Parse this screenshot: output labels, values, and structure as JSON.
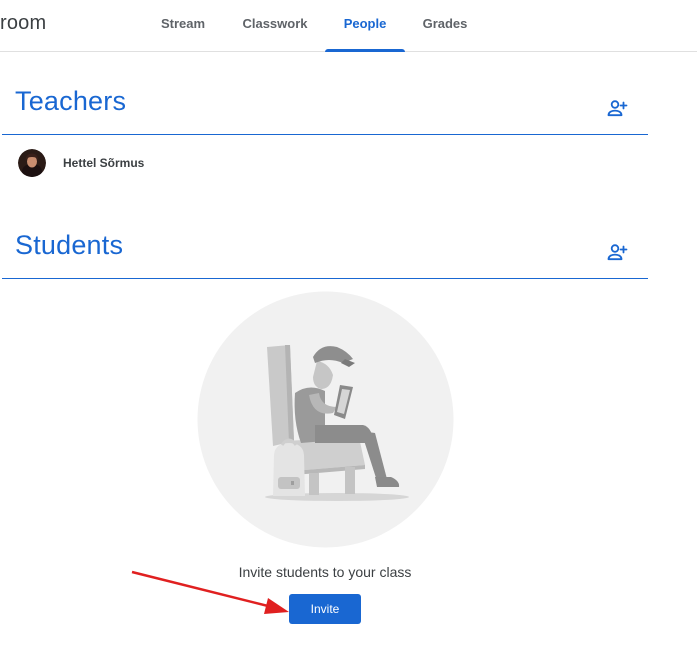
{
  "header": {
    "app_title": "room",
    "tabs": [
      {
        "label": "Stream",
        "active": false
      },
      {
        "label": "Classwork",
        "active": false
      },
      {
        "label": "People",
        "active": true
      },
      {
        "label": "Grades",
        "active": false
      }
    ]
  },
  "teachers": {
    "title": "Teachers",
    "list": [
      {
        "name": "Hettel Sõrmus"
      }
    ]
  },
  "students": {
    "title": "Students",
    "empty_message": "Invite students to your class",
    "invite_label": "Invite"
  },
  "colors": {
    "accent": "#1967d2",
    "annotation_arrow": "#e02020"
  },
  "icons": {
    "add_person": "person-add-icon"
  }
}
